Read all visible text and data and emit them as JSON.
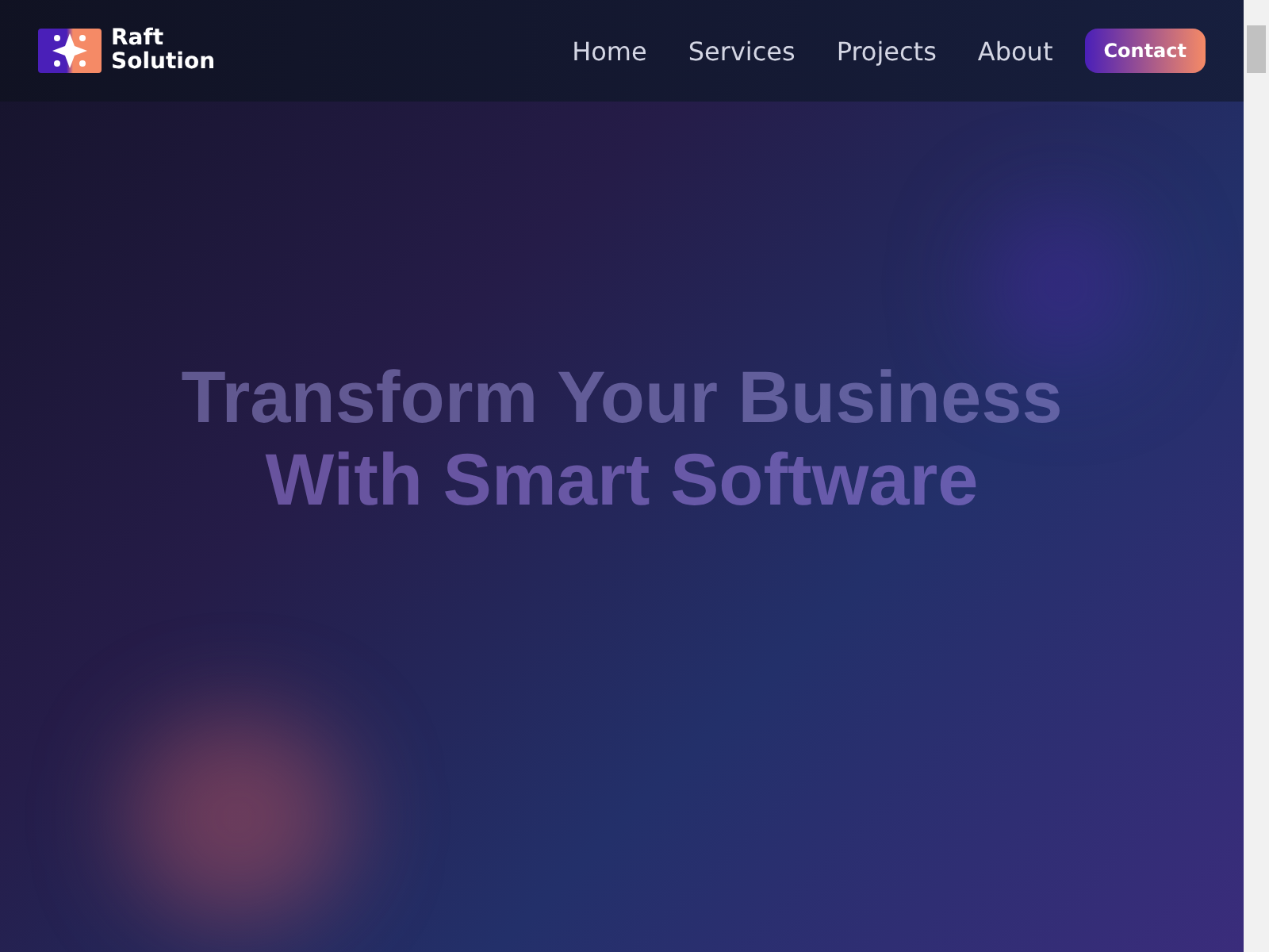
{
  "logo": {
    "line_1": "Raft",
    "line_2": "Solution"
  },
  "nav": [
    {
      "label": "Home",
      "kind": "link"
    },
    {
      "label": "Services",
      "kind": "link"
    },
    {
      "label": "Projects",
      "kind": "link"
    },
    {
      "label": "About",
      "kind": "link"
    },
    {
      "label": "Contact",
      "kind": "cta"
    }
  ],
  "hero": {
    "headline_line_1": "Transform Your Business",
    "headline_line_2": "With Smart Software"
  }
}
